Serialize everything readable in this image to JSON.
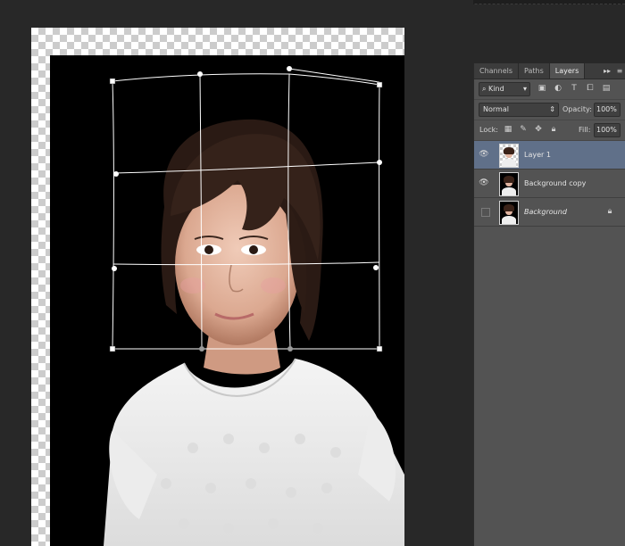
{
  "panel": {
    "tabs": [
      {
        "label": "Channels"
      },
      {
        "label": "Paths"
      },
      {
        "label": "Layers"
      }
    ],
    "filter": {
      "kind_label": "Kind"
    },
    "blend": {
      "mode": "Normal",
      "opacity_label": "Opacity:",
      "opacity_value": "100%"
    },
    "lock": {
      "label": "Lock:",
      "fill_label": "Fill:",
      "fill_value": "100%"
    },
    "layers": [
      {
        "name": "Layer 1",
        "selected": true,
        "visible": true
      },
      {
        "name": "Background copy",
        "selected": false,
        "visible": true
      },
      {
        "name": "Background",
        "selected": false,
        "visible": false,
        "locked": true
      }
    ]
  },
  "colors": {
    "workspace": "#282828",
    "panel": "#535353",
    "selected_layer": "#607089",
    "warp_grid": "#ffffff"
  }
}
